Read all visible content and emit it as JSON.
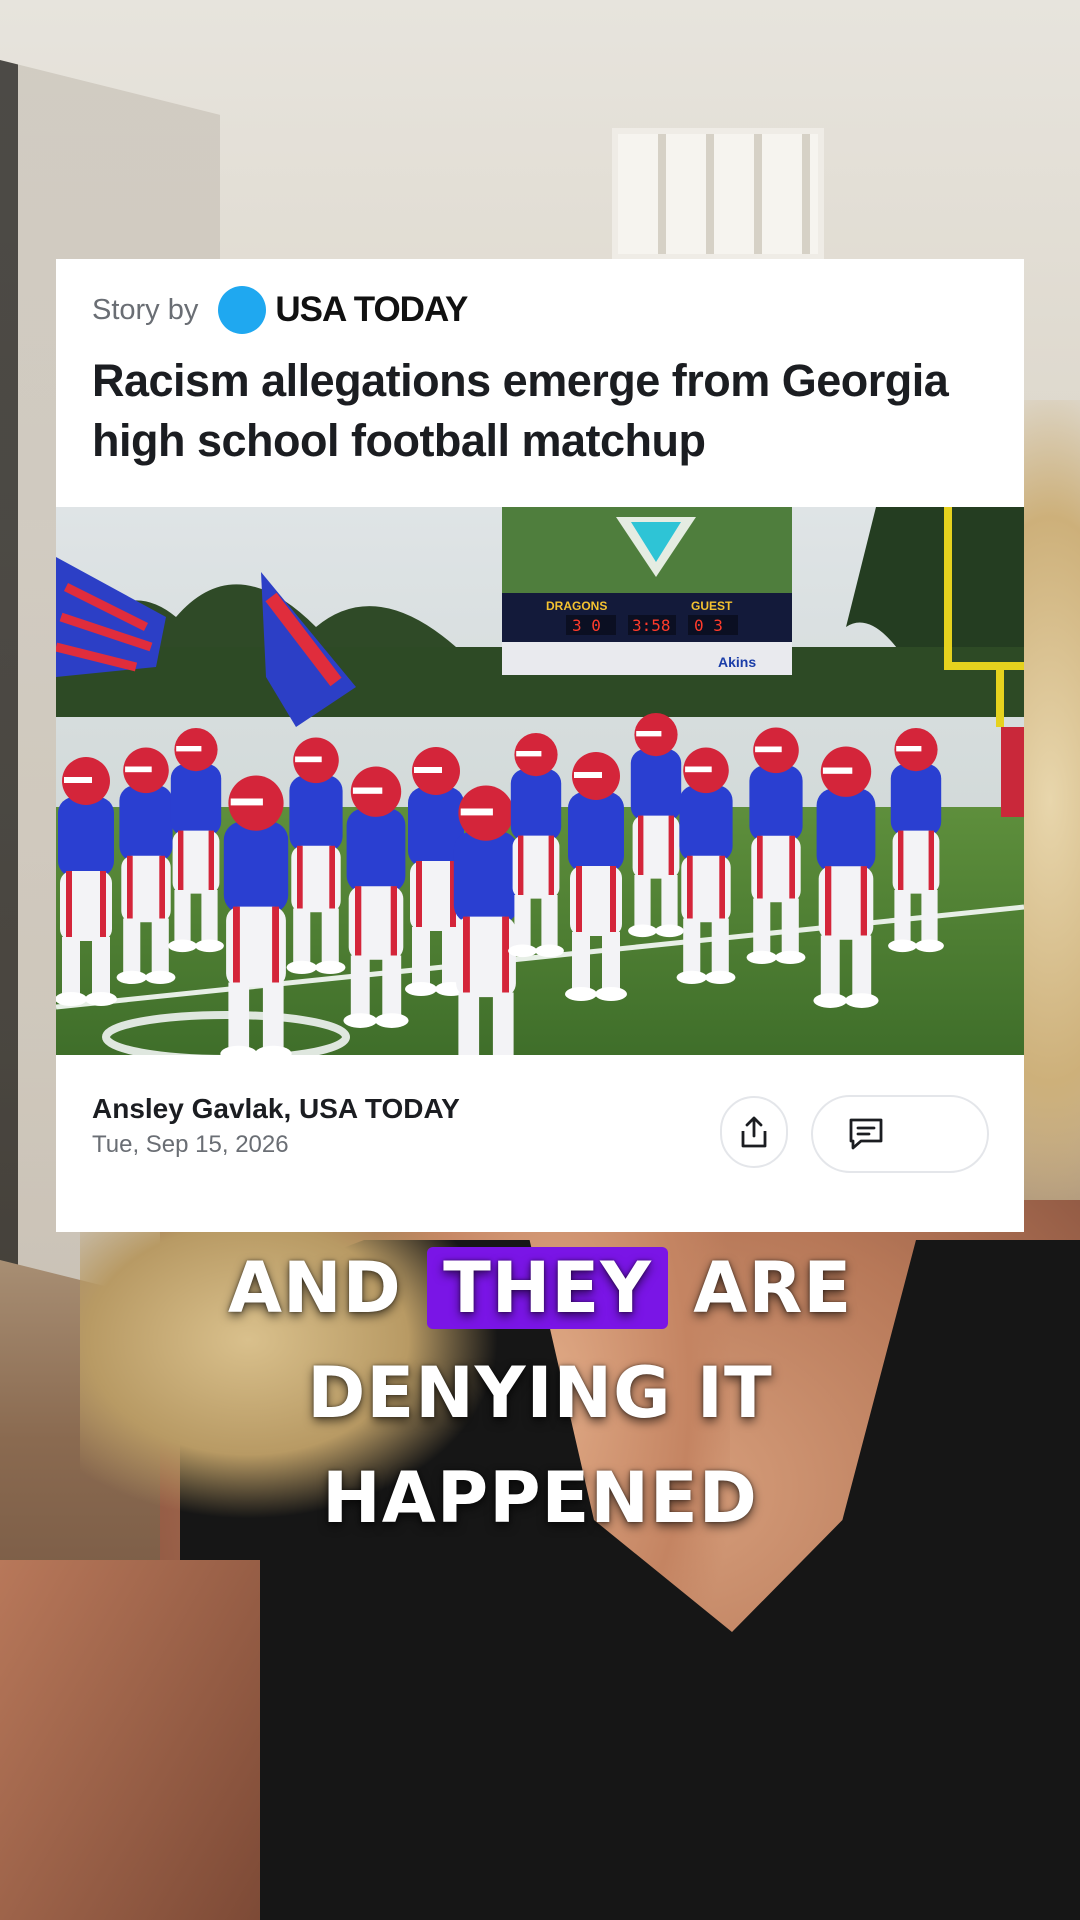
{
  "article": {
    "story_by": "Story by",
    "brand": "USA TODAY",
    "headline": "Racism allegations emerge from Georgia high school football matchup",
    "author": "Ansley Gavlak, USA TODAY",
    "date": "Tue, Sep 15, 2026"
  },
  "scoreboard": {
    "home_label": "DRAGONS",
    "guest_label": "GUEST",
    "home_score": "3 0",
    "clock": "3:58",
    "guest_score": "0 3",
    "sponsor": "Akins"
  },
  "captions": {
    "line1_before": "AND",
    "line1_highlight": "THEY",
    "line1_after": "ARE",
    "line2": "DENYING IT",
    "line3": "HAPPENED"
  },
  "icons": {
    "share": "share-icon",
    "comment": "comment-icon"
  },
  "colors": {
    "caption_highlight": "#7a15e6",
    "brand_dot": "#1fa8f0",
    "uniform_blue": "#2a3fd1",
    "helmet_red": "#d4253a"
  }
}
